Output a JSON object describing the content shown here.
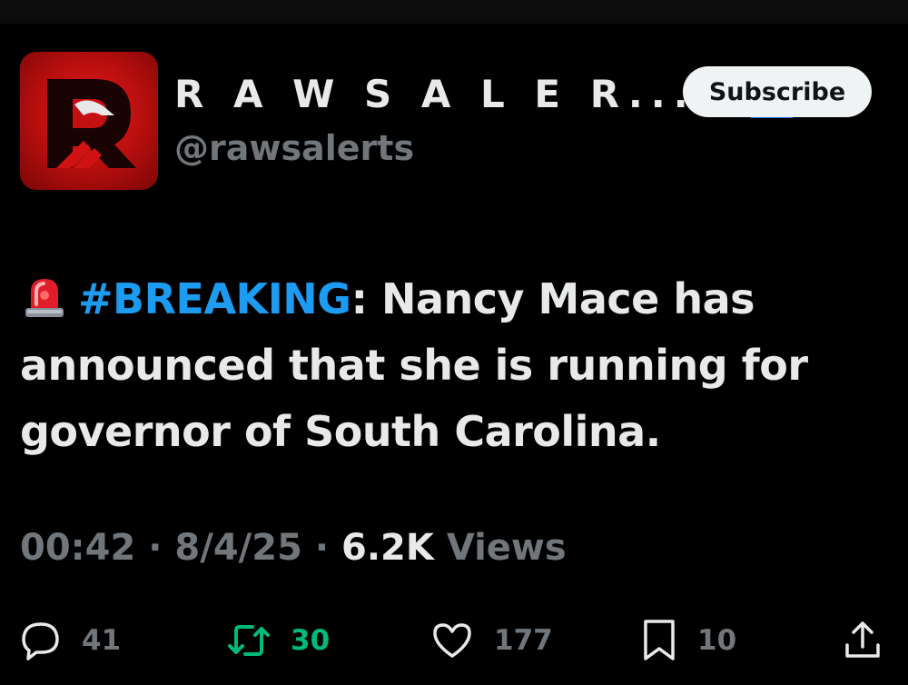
{
  "account": {
    "display_name": "R A W S A L E R...",
    "handle": "@rawsalerts"
  },
  "subscribe_label": "Subscribe",
  "tweet": {
    "hashtag": "#BREAKING",
    "text": ": Nancy Mace has announced that she is running for governor of South Carolina."
  },
  "meta": {
    "time": "00:42",
    "date": "8/4/25",
    "views_count": "6.2K",
    "views_label": "Views",
    "separator": "·"
  },
  "actions": {
    "replies": "41",
    "retweets": "30",
    "likes": "177",
    "bookmarks": "10"
  },
  "colors": {
    "background": "#000000",
    "text": "#e7e9ea",
    "muted": "#71767b",
    "hashtag": "#1d9bf0",
    "retweet": "#00ba7c",
    "verified": "#e8b32d",
    "affiliate": "#1d6ff2"
  },
  "icons": {
    "verified": "verified-badge-icon",
    "affiliate": "affiliate-badge-icon",
    "siren": "police-siren-emoji",
    "reply": "reply-icon",
    "retweet": "retweet-icon",
    "like": "heart-icon",
    "bookmark": "bookmark-icon",
    "share": "share-icon"
  }
}
